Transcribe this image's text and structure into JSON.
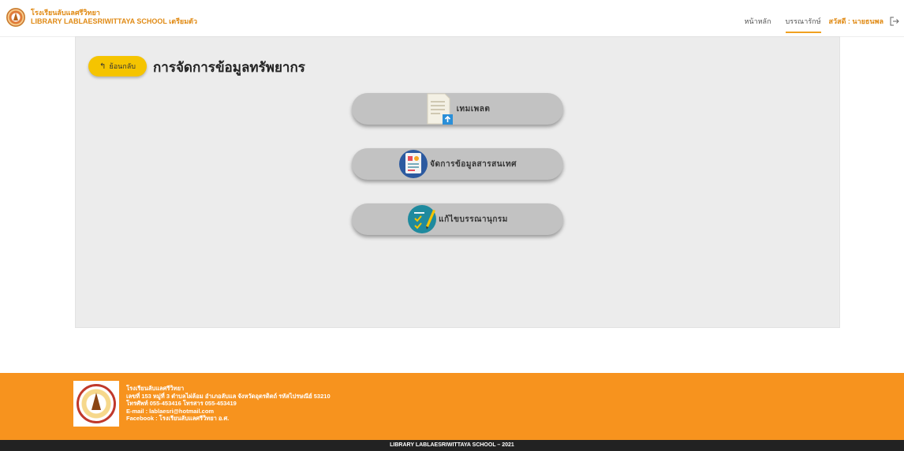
{
  "header": {
    "brand_line1": "โรงเรียนลับแลศรีวิทยา",
    "brand_line2": "LIBRARY LABLAESRIWITTAYA SCHOOL เตรียมตัว",
    "nav": [
      "หน้าหลัก",
      "บรรณารักษ์"
    ],
    "user": "สวัสดี : นายธนพล",
    "accent": "#e08a14"
  },
  "main": {
    "back_label": "ย้อนกลับ",
    "title": "การจัดการข้อมูลทรัพยากร",
    "buttons": [
      {
        "label": "เทมเพลต",
        "icon": "document-upload-icon"
      },
      {
        "label": "จัดการข้อมูลสารสนเทศ",
        "icon": "report-icon"
      },
      {
        "label": "แก้ไขบรรณานุกรม",
        "icon": "checklist-pen-icon"
      }
    ]
  },
  "footer": {
    "line1": "โรงเรียนลับแลศรีวิทยา",
    "line2": "เลขที่ 153 หมู่ที่ 3 ตำบลไผ่ล้อม อำเภอลับแล จังหวัดอุตรดิตถ์ รหัสไปรษณีย์ 53210",
    "line3": "โทรศัพท์ 055-453416 โทรสาร 055-453419",
    "line4": "E-mail : lablaesri@hotmail.com",
    "line5": "Facebook : โรงเรียนลับแลศรีวิทยา อ.ศ.",
    "copyright": "LIBRARY LABLAESRIWITTAYA SCHOOL – 2021",
    "color": "#f7931e"
  }
}
